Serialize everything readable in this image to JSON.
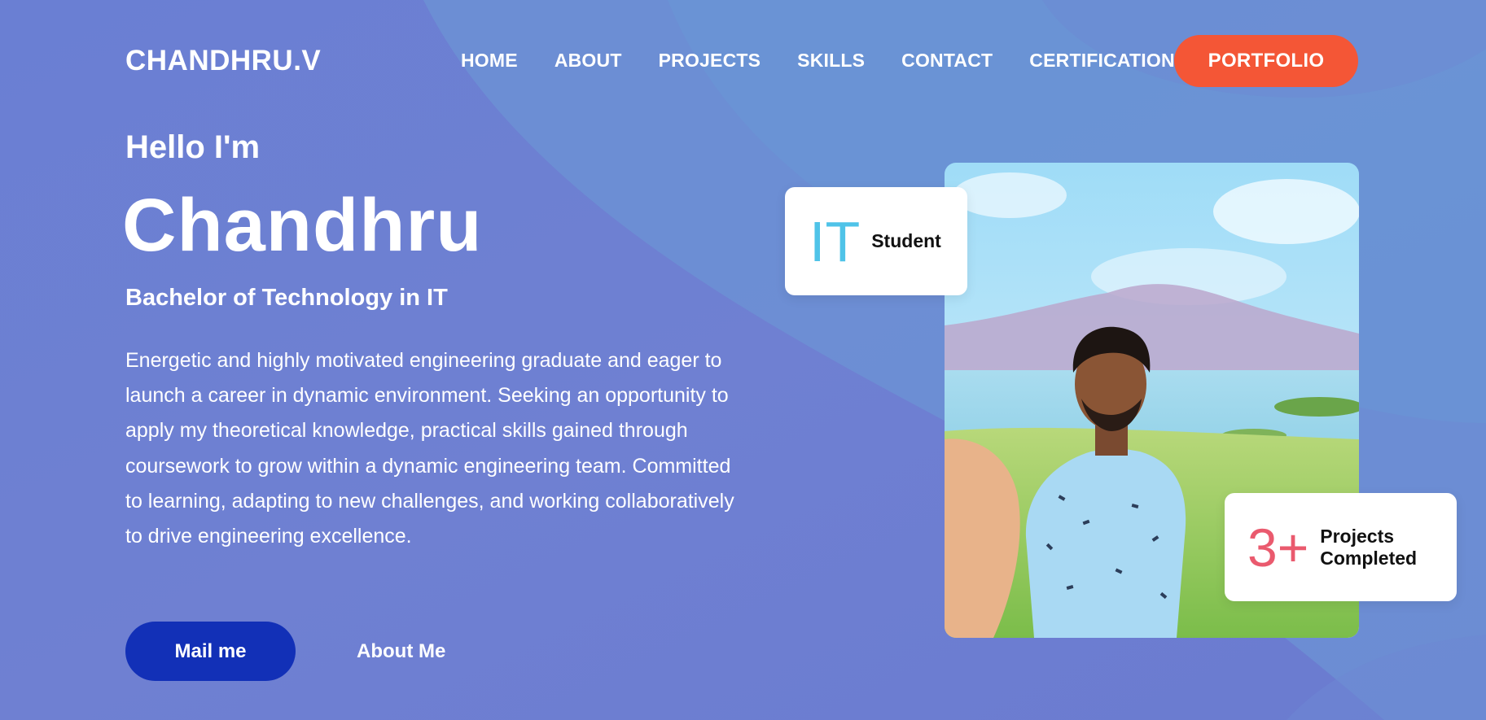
{
  "header": {
    "logo": "CHANDHRU.V",
    "nav": [
      "HOME",
      "ABOUT",
      "PROJECTS",
      "SKILLS",
      "CONTACT",
      "CERTIFICATIONS"
    ],
    "cta": "PORTFOLIO"
  },
  "hero": {
    "greeting": "Hello I'm",
    "name": "Chandhru",
    "degree": "Bachelor of Technology in IT",
    "bio": "Energetic and highly motivated engineering graduate and eager to launch a career in dynamic environment. Seeking an opportunity to apply my theoretical knowledge, practical skills gained through coursework to grow within a dynamic engineering team. Committed to learning, adapting to new challenges, and working collaboratively to drive engineering excellence.",
    "mail_button": "Mail me",
    "about_button": "About Me"
  },
  "cards": {
    "role_big": "IT",
    "role_label": "Student",
    "projects_big": "3+",
    "projects_label": "Projects Completed"
  },
  "colors": {
    "background": "#6c7fd0",
    "cta": "#f45636",
    "mail_button": "#1230b7",
    "it_accent": "#4fc3e8",
    "projects_accent": "#ea5a6e"
  },
  "icons": {
    "profile_photo": "profile-photo"
  }
}
